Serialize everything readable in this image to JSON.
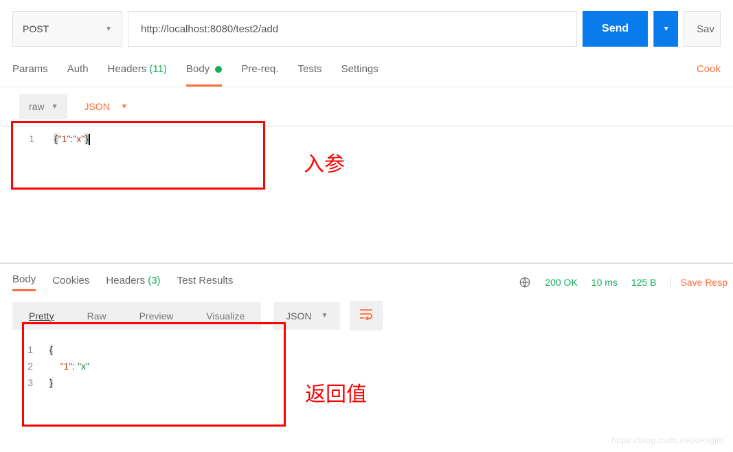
{
  "method": {
    "value": "POST"
  },
  "url": {
    "value": "http://localhost:8080/test2/add"
  },
  "send_label": "Send",
  "save_label": "Sav",
  "req_tabs": {
    "params": "Params",
    "auth": "Auth",
    "headers": "Headers",
    "headers_count": "(11)",
    "body": "Body",
    "prereq": "Pre-req.",
    "tests": "Tests",
    "settings": "Settings",
    "cookies": "Cook"
  },
  "body_sub": {
    "raw": "raw",
    "format": "JSON"
  },
  "request_body": {
    "lines": [
      {
        "ln": "1",
        "raw": "{\"1\":\"x\"}"
      }
    ]
  },
  "annotations": {
    "input_label": "入参",
    "output_label": "返回值"
  },
  "resp_tabs": {
    "body": "Body",
    "cookies": "Cookies",
    "headers": "Headers",
    "headers_count": "(3)",
    "test_results": "Test Results"
  },
  "status": {
    "code": "200 OK",
    "time": "10 ms",
    "size": "125 B",
    "save": "Save Resp"
  },
  "resp_view": {
    "pretty": "Pretty",
    "raw": "Raw",
    "preview": "Preview",
    "visualize": "Visualize",
    "format": "JSON"
  },
  "response_body": {
    "lines": [
      {
        "ln": "1"
      },
      {
        "ln": "2",
        "key": "\"1\"",
        "val": "\"x\""
      },
      {
        "ln": "3"
      }
    ]
  },
  "watermark": "https://blog.csdn.net/dengjili"
}
